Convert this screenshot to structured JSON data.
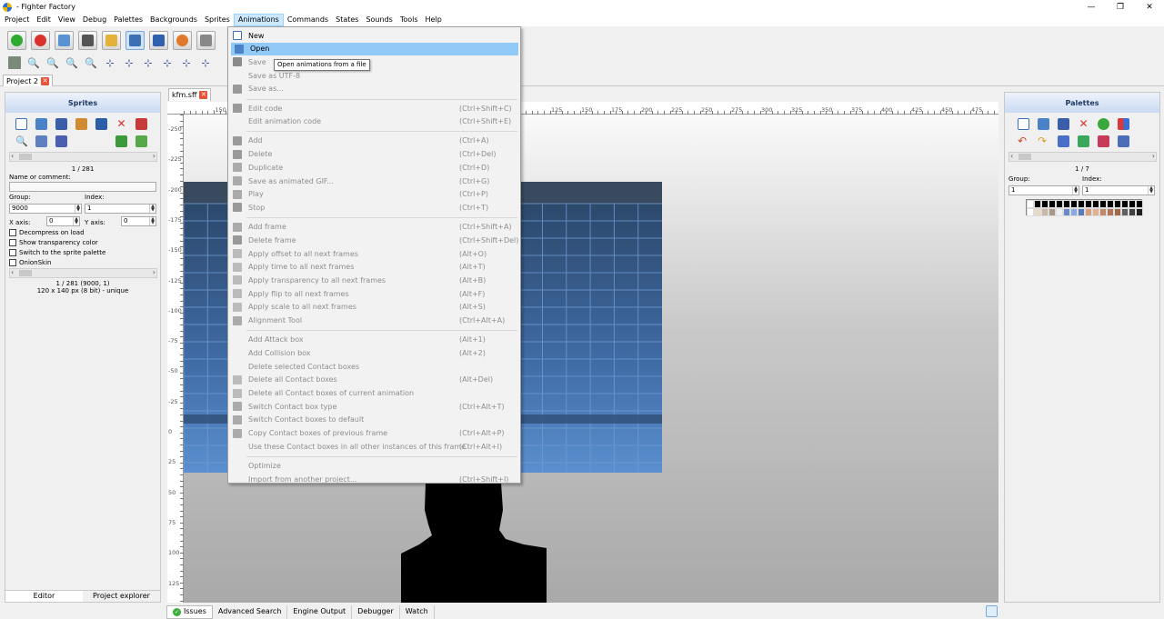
{
  "window": {
    "title": "- Fighter Factory",
    "controls": [
      "—",
      "❐",
      "✕"
    ]
  },
  "menubar": [
    "Project",
    "Edit",
    "View",
    "Debug",
    "Palettes",
    "Backgrounds",
    "Sprites",
    "Animations",
    "Commands",
    "States",
    "Sounds",
    "Tools",
    "Help"
  ],
  "active_menu": "Animations",
  "project_tab": {
    "label": "Project 2"
  },
  "doc_tab": {
    "label": "kfm.sff"
  },
  "sprites_panel": {
    "title": "Sprites",
    "counter": "1 / 281",
    "name_label": "Name or comment:",
    "group_label": "Group:",
    "group_value": "9000",
    "index_label": "Index:",
    "index_value": "1",
    "xaxis_label": "X axis:",
    "xaxis_value": "0",
    "yaxis_label": "Y axis:",
    "yaxis_value": "0",
    "checkboxes": [
      "Decompress on load",
      "Show transparency color",
      "Switch to the sprite palette",
      "OnionSkin"
    ],
    "info_line1": "1 / 281 (9000, 1)",
    "info_line2": "120 x 140 px (8 bit) - unique",
    "tabs": [
      "Editor",
      "Project explorer"
    ]
  },
  "palettes_panel": {
    "title": "Palettes",
    "counter": "1 / 7",
    "group_label": "Group:",
    "group_value": "1",
    "index_label": "Index:",
    "index_value": "1"
  },
  "ruler": {
    "top_labels": [
      "-150",
      "125",
      "150",
      "175",
      "200",
      "225",
      "250",
      "275",
      "300",
      "325",
      "350",
      "375",
      "400",
      "425",
      "450",
      "475"
    ],
    "left_labels": [
      "-250",
      "-225",
      "-200",
      "-175",
      "-150",
      "-125",
      "-100",
      "-75",
      "-50",
      "-25",
      "0",
      "25",
      "50",
      "75",
      "100",
      "125"
    ]
  },
  "animations_menu": [
    {
      "label": "New",
      "shortcut": "",
      "icon": "new-file-icon",
      "disabled": false
    },
    {
      "label": "Open",
      "shortcut": "",
      "icon": "open-folder-icon",
      "disabled": false,
      "highlighted": true
    },
    {
      "label": "Save",
      "shortcut": "",
      "icon": "save-icon",
      "disabled": true
    },
    {
      "label": "Save as UTF-8",
      "shortcut": "",
      "icon": "",
      "disabled": true
    },
    {
      "label": "Save as...",
      "shortcut": "",
      "icon": "save-as-icon",
      "disabled": true
    },
    {
      "sep": true
    },
    {
      "label": "Edit code",
      "shortcut": "(Ctrl+Shift+C)",
      "icon": "code-icon",
      "disabled": true
    },
    {
      "label": "Edit animation code",
      "shortcut": "(Ctrl+Shift+E)",
      "icon": "",
      "disabled": true
    },
    {
      "sep": true
    },
    {
      "label": "Add",
      "shortcut": "(Ctrl+A)",
      "icon": "add-icon",
      "disabled": true
    },
    {
      "label": "Delete",
      "shortcut": "(Ctrl+Del)",
      "icon": "delete-icon",
      "disabled": true
    },
    {
      "label": "Duplicate",
      "shortcut": "(Ctrl+D)",
      "icon": "duplicate-icon",
      "disabled": true
    },
    {
      "label": "Save as animated GIF...",
      "shortcut": "(Ctrl+G)",
      "icon": "gif-icon",
      "disabled": true
    },
    {
      "label": "Play",
      "shortcut": "(Ctrl+P)",
      "icon": "play-icon",
      "disabled": true
    },
    {
      "label": "Stop",
      "shortcut": "(Ctrl+T)",
      "icon": "stop-icon",
      "disabled": true
    },
    {
      "sep": true
    },
    {
      "label": "Add frame",
      "shortcut": "(Ctrl+Shift+A)",
      "icon": "add-frame-icon",
      "disabled": true
    },
    {
      "label": "Delete frame",
      "shortcut": "(Ctrl+Shift+Del)",
      "icon": "delete-frame-icon",
      "disabled": true
    },
    {
      "label": "Apply offset to all next frames",
      "shortcut": "(Alt+O)",
      "icon": "apply-icon",
      "disabled": true
    },
    {
      "label": "Apply time to all next frames",
      "shortcut": "(Alt+T)",
      "icon": "apply-icon",
      "disabled": true
    },
    {
      "label": "Apply transparency to all next frames",
      "shortcut": "(Alt+B)",
      "icon": "apply-icon",
      "disabled": true
    },
    {
      "label": "Apply flip to all next frames",
      "shortcut": "(Alt+F)",
      "icon": "apply-icon",
      "disabled": true
    },
    {
      "label": "Apply scale to all next frames",
      "shortcut": "(Alt+S)",
      "icon": "apply-icon",
      "disabled": true
    },
    {
      "label": "Alignment Tool",
      "shortcut": "(Ctrl+Alt+A)",
      "icon": "alignment-icon",
      "disabled": true
    },
    {
      "sep": true
    },
    {
      "label": "Add Attack box",
      "shortcut": "(Alt+1)",
      "icon": "",
      "disabled": true
    },
    {
      "label": "Add Collision box",
      "shortcut": "(Alt+2)",
      "icon": "",
      "disabled": true
    },
    {
      "label": "Delete selected Contact boxes",
      "shortcut": "",
      "icon": "",
      "disabled": true
    },
    {
      "label": "Delete all Contact boxes",
      "shortcut": "(Alt+Del)",
      "icon": "box-icon",
      "disabled": true
    },
    {
      "label": "Delete all Contact boxes of current animation",
      "shortcut": "",
      "icon": "box-icon",
      "disabled": true
    },
    {
      "label": "Switch Contact box type",
      "shortcut": "(Ctrl+Alt+T)",
      "icon": "switch-icon",
      "disabled": true
    },
    {
      "label": "Switch Contact boxes to default",
      "shortcut": "",
      "icon": "switch-icon",
      "disabled": true
    },
    {
      "label": "Copy Contact boxes of previous frame",
      "shortcut": "(Ctrl+Alt+P)",
      "icon": "copy-icon",
      "disabled": true
    },
    {
      "label": "Use these Contact boxes in all other instances of this frame",
      "shortcut": "(Ctrl+Alt+I)",
      "icon": "",
      "disabled": true
    },
    {
      "sep": true
    },
    {
      "label": "Optimize",
      "shortcut": "",
      "icon": "",
      "disabled": true
    },
    {
      "label": "Import from another project...",
      "shortcut": "(Ctrl+Shift+I)",
      "icon": "",
      "disabled": true
    }
  ],
  "tooltip": "Open animations from a file",
  "bottom_tabs": [
    "Issues",
    "Advanced Search",
    "Engine Output",
    "Debugger",
    "Watch"
  ],
  "colors": {
    "menu_highlight": "#91c9f7",
    "panel_header": "#c9daf3",
    "bg_blue": "#4f7fb5"
  }
}
